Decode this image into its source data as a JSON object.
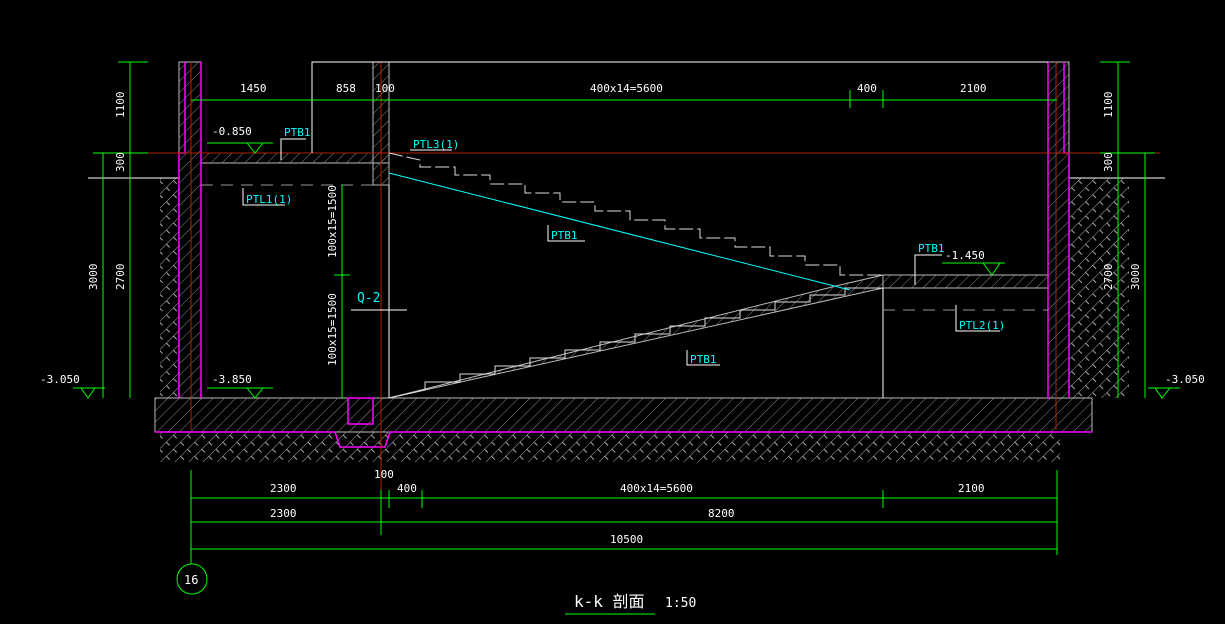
{
  "drawing": {
    "title": "k-k 剖面",
    "scale": "1:50",
    "axis_bubble": "16",
    "top_dims": [
      "1450",
      "858",
      "100",
      "400x14=5600",
      "400",
      "2100"
    ],
    "bottom_dims_row1": [
      "100",
      "2300",
      "400",
      "400x14=5600",
      "2100"
    ],
    "bottom_dims_row2": [
      "2300",
      "8200"
    ],
    "bottom_dims_row3": [
      "10500"
    ],
    "left_vertical_dims": [
      "1100",
      "300",
      "2700",
      "3000"
    ],
    "right_vertical_dims": [
      "1100",
      "300",
      "2700",
      "3000"
    ],
    "stair_dims": [
      "100x15=1500",
      "100x15=1500"
    ],
    "elevations": {
      "top_left": "-0.850",
      "outside_left": "-3.050",
      "floor_left": "-3.850",
      "landing": "-1.450",
      "outside_right": "-3.050"
    },
    "labels": {
      "ptb1_top": "PTB1",
      "ptl3": "PTL3(1)",
      "ptl1": "PTL1(1)",
      "ptb1_upper": "PTB1",
      "q2": "Q-2",
      "ptb1_lower": "PTB1",
      "ptb1_landing": "PTB1",
      "ptl2": "PTL2(1)"
    },
    "colors": {
      "dim": "#00ff00",
      "wall": "#ff00ff",
      "label": "#00ffff",
      "axis": "#b02000"
    }
  }
}
